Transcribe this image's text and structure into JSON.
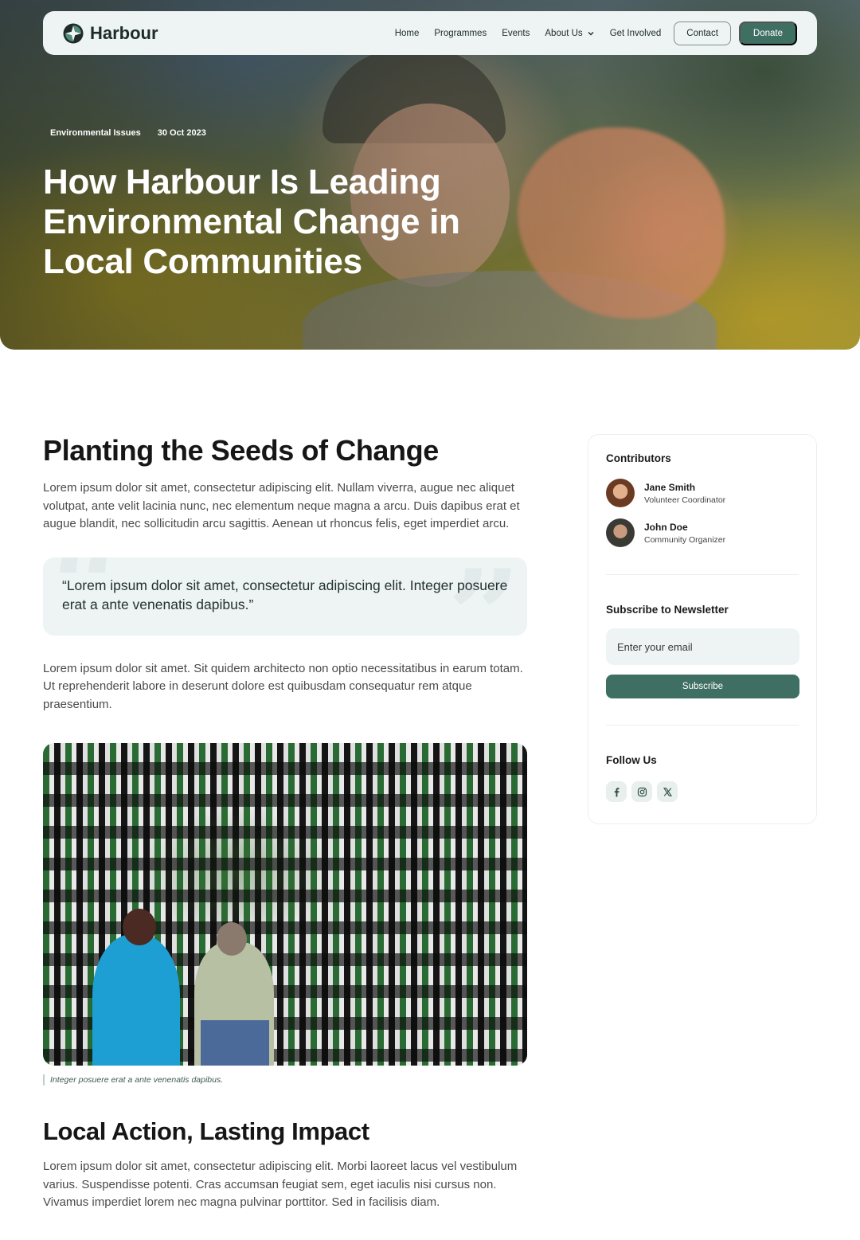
{
  "nav": {
    "logo_text": "Harbour",
    "links": [
      {
        "label": "Home"
      },
      {
        "label": "Programmes"
      },
      {
        "label": "Events"
      },
      {
        "label": "About Us"
      },
      {
        "label": "Get Involved"
      }
    ],
    "contact_label": "Contact",
    "donate_label": "Donate",
    "logo_icon": "harbour-logo-icon",
    "dropdown_icon": "chevron-down-icon"
  },
  "hero": {
    "category": "Environmental Issues",
    "date": "30 Oct 2023",
    "title": "How Harbour Is Leading Environmental Change in Local Communities"
  },
  "article": {
    "heading_1": "Planting the Seeds of Change",
    "paragraph_1": "Lorem ipsum dolor sit amet, consectetur adipiscing elit. Nullam viverra, augue nec aliquet volutpat, ante velit lacinia nunc, nec elementum neque magna a arcu. Duis dapibus erat et augue blandit, nec sollicitudin arcu sagittis. Aenean ut rhoncus felis, eget imperdiet arcu.",
    "quote": "“Lorem ipsum dolor sit amet, consectetur adipiscing elit. Integer posuere erat a ante venenatis dapibus.”",
    "paragraph_2": "Lorem ipsum dolor sit amet. Sit quidem architecto non optio necessitatibus in earum totam. Ut reprehenderit labore in deserunt dolore est quibusdam consequatur rem atque praesentium.",
    "image_caption": "Integer posuere erat a ante venenatis dapibus.",
    "heading_2": "Local Action, Lasting Impact",
    "paragraph_3": "Lorem ipsum dolor sit amet, consectetur adipiscing elit. Morbi laoreet lacus vel vestibulum varius. Suspendisse potenti. Cras accumsan feugiat sem, eget iaculis nisi cursus non. Vivamus imperdiet lorem nec magna pulvinar porttitor. Sed in facilisis diam."
  },
  "sidebar": {
    "contributors_title": "Contributors",
    "contributors": [
      {
        "name": "Jane Smith",
        "role": "Volunteer Coordinator"
      },
      {
        "name": "John Doe",
        "role": "Community Organizer"
      }
    ],
    "newsletter_title": "Subscribe to Newsletter",
    "email_placeholder": "Enter your email",
    "subscribe_label": "Subscribe",
    "follow_title": "Follow Us",
    "socials": [
      "facebook-icon",
      "instagram-icon",
      "x-icon"
    ]
  },
  "colors": {
    "accent": "#3f6e63",
    "surface": "#eef3f4",
    "text": "#161616"
  }
}
